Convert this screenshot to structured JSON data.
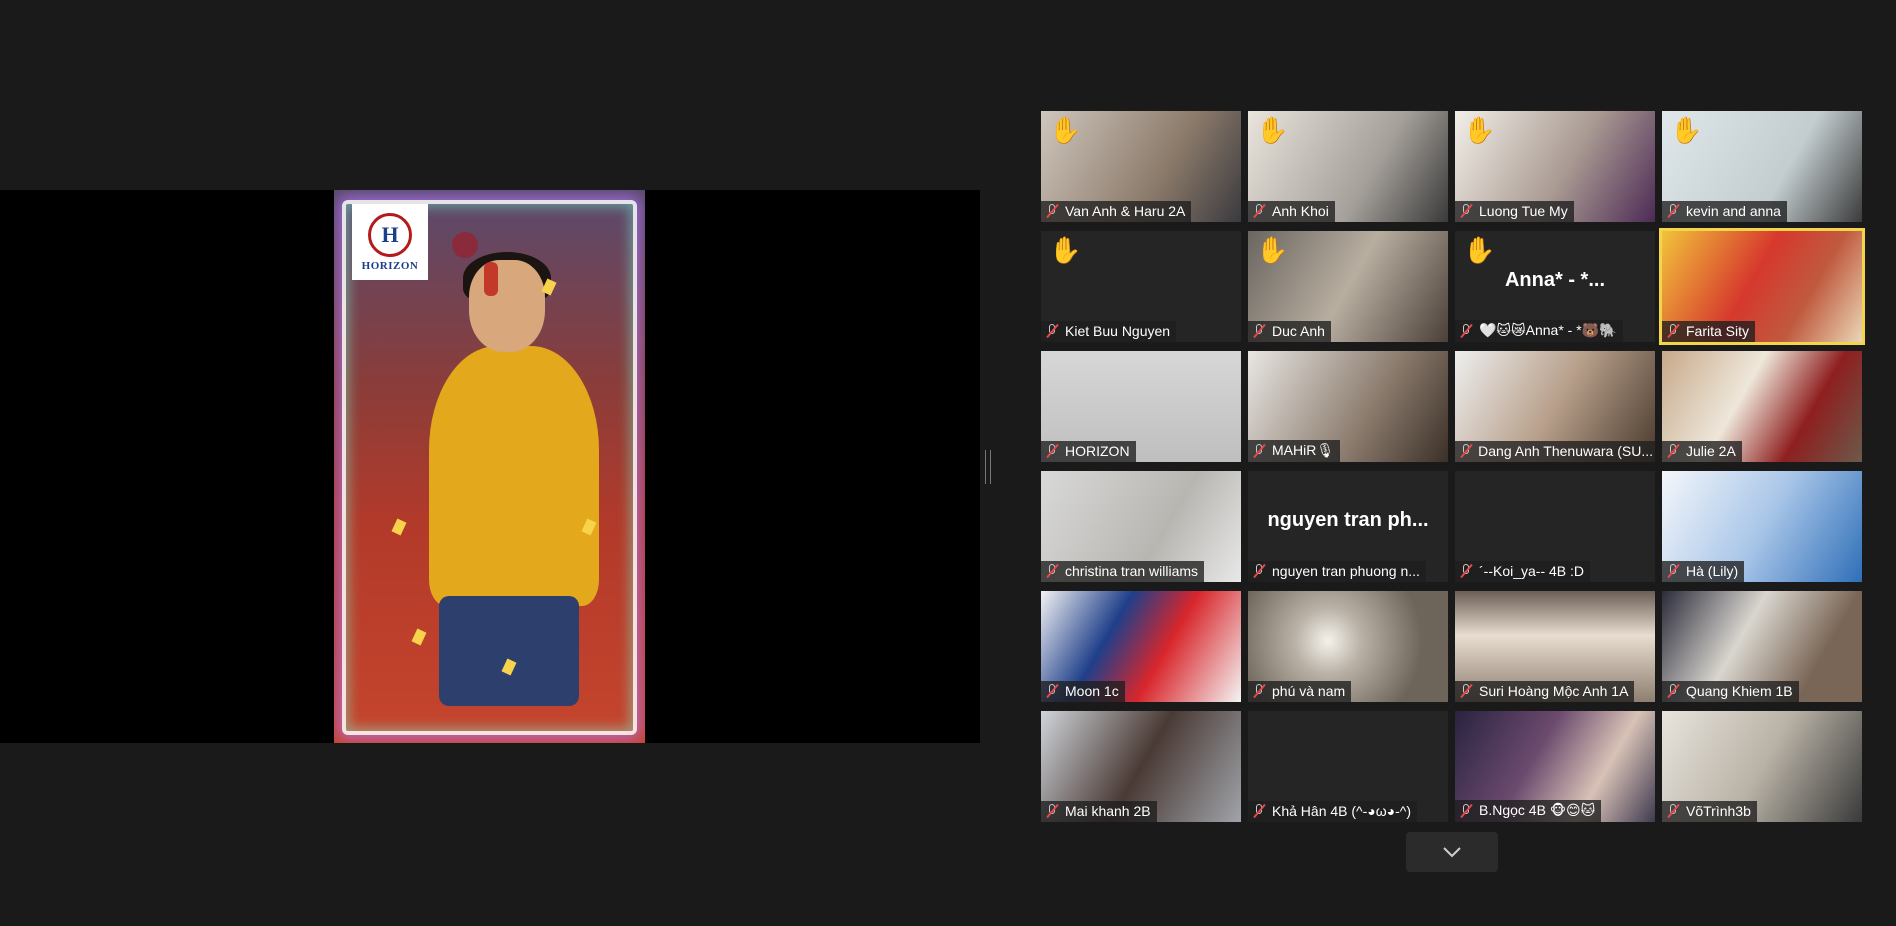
{
  "speaker": {
    "logo_text": "HORIZON",
    "logo_letter": "H"
  },
  "gallery": {
    "tiles": [
      {
        "name": "Van Anh & Haru 2A",
        "hand": "✋",
        "bg": "linear-gradient(120deg,#cfc6bd,#8b7a6a 60%,#3b3a3f)",
        "hand_color": "#f5c26b"
      },
      {
        "name": "Anh Khoi",
        "hand": "✋",
        "bg": "linear-gradient(120deg,#e9e4dc,#a5a09a 60%,#3a3a3a)",
        "hand_color": "#f5c26b"
      },
      {
        "name": "Luong Tue My",
        "hand": "✋",
        "bg": "linear-gradient(120deg,#f2efe8,#a99a92 55%,#4d2a55)",
        "hand_color": "#f5c26b"
      },
      {
        "name": "kevin and anna",
        "hand": "✋",
        "bg": "linear-gradient(120deg,#dfe7ea,#c3cdd0 60%,#3b3b3b)",
        "hand_color": "#f7d3a6"
      },
      {
        "name": "Kiet Buu Nguyen",
        "hand": "✋",
        "bg": "#252525",
        "hand_color": "#f5c21b"
      },
      {
        "name": "Duc Anh",
        "hand": "✋",
        "bg": "linear-gradient(120deg,#6a6560,#b8aea0 50%,#4a4038)",
        "hand_color": "#f5c21b"
      },
      {
        "name": "🤍🐱😿Anna* - *🐻🐘",
        "hand": "✋",
        "bg": "#252525",
        "hand_color": "#f5c21b",
        "center_text": "󠀠󠀠󠀠Anna* - *..."
      },
      {
        "name": "Farita Sity",
        "hand": "",
        "bg": "linear-gradient(120deg,#f2c33b,#d6382d 45%,#c05a3f 70%,#e9d7b6)",
        "active": true
      },
      {
        "name": "HORIZON",
        "hand": "",
        "bg": "linear-gradient(180deg,#d7d7d7,#bfbfbf)"
      },
      {
        "name": "MAHiR🎙",
        "hand": "",
        "bg": "linear-gradient(120deg,#e8e6e3,#8a7a6c 60%,#3b3028)"
      },
      {
        "name": "Dang Anh Thenuwara (SU...",
        "hand": "",
        "bg": "linear-gradient(120deg,#eeeeee,#b79f8a 50%,#4a3a2e)"
      },
      {
        "name": "Julie 2A",
        "hand": "",
        "bg": "linear-gradient(120deg,#c7a98a,#eee7da 40%,#8e1f1f 70%,#6b5a4a)"
      },
      {
        "name": "christina tran williams",
        "hand": "",
        "bg": "linear-gradient(120deg,#d9d9d9,#b8b6b1 60%,#e8e8e8)"
      },
      {
        "name": "nguyen tran phuong n...",
        "hand": "",
        "bg": "#252525",
        "center_text": "nguyen tran ph..."
      },
      {
        "name": "´--Koi_ya-- 4B :D",
        "hand": "",
        "bg": "#252525"
      },
      {
        "name": "Hà (Lily)",
        "hand": "",
        "bg": "linear-gradient(120deg,#f4f7fb,#a9c6e8 50%,#2f6fb8)"
      },
      {
        "name": "Moon 1c",
        "hand": "",
        "bg": "linear-gradient(120deg,#f2f2f2,#1f3f8a 35%,#d8262b 60%,#f4f4f4)"
      },
      {
        "name": "phú và nam",
        "hand": "",
        "bg": "radial-gradient(circle at 40% 45%,#f5f2ec 0%,#b9b1a6 25%,#6d645a 70%)"
      },
      {
        "name": "Suri Hoàng Mộc Anh 1A",
        "hand": "",
        "bg": "linear-gradient(180deg,#6b5e55,#e8ddd0 40%,#8e7f70)"
      },
      {
        "name": "Quang Khiem 1B",
        "hand": "",
        "bg": "linear-gradient(120deg,#2b2b3a,#d9d6cf 40%,#7a6656 75%)"
      },
      {
        "name": "Mai khanh 2B",
        "hand": "",
        "bg": "linear-gradient(120deg,#cfd4da,#4a3a35 50%,#a0a4aa)"
      },
      {
        "name": "Khả Hân 4B (^-◕ω◕-^)",
        "hand": "",
        "bg": "#252525"
      },
      {
        "name": "B.Ngọc 4B 🐵😊🐱",
        "hand": "",
        "bg": "linear-gradient(120deg,#2a2340,#6b4a6e 40%,#d8c2b6 70%,#403a50)"
      },
      {
        "name": "VõTrình3b",
        "hand": "",
        "bg": "linear-gradient(120deg,#e8e4dd,#b9b2a6 50%,#3a3a3a)"
      }
    ]
  },
  "controls": {
    "scroll_down_label": ""
  }
}
